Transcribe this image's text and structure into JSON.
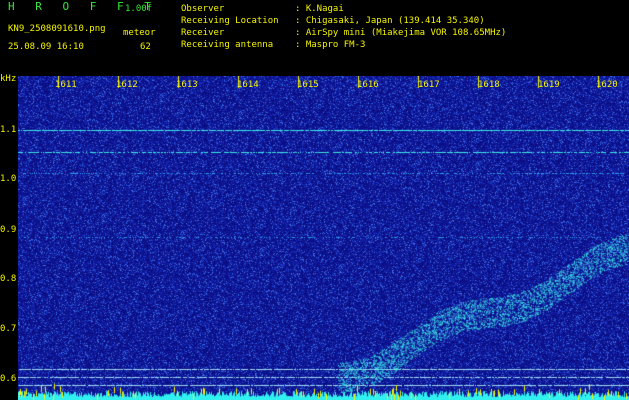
{
  "header": {
    "app_title": "H R O F F T",
    "version": "1.00f",
    "filename": "KN9_2508091610.png",
    "meteor_label": "meteor",
    "datetime": "25.08.09 16:10",
    "meteor_count": "62",
    "info": [
      {
        "label": "Observer",
        "value": ": K.Nagai"
      },
      {
        "label": "Receiving Location",
        "value": ": Chigasaki, Japan (139.414 35.340)"
      },
      {
        "label": "Receiver",
        "value": ": AirSpy mini (Miakejima VOR 108.65MHz)"
      },
      {
        "label": "Receiving antenna",
        "value": ": Maspro FM-3"
      }
    ]
  },
  "y_axis": {
    "unit": "kHz",
    "ticks": [
      "1.1",
      "1.0",
      "0.9",
      "0.8",
      "0.7",
      "0.6"
    ]
  },
  "time_axis": {
    "ticks": [
      "1611",
      "1612",
      "1613",
      "1614",
      "1615",
      "1616",
      "1617",
      "1618",
      "1619",
      "1620"
    ]
  },
  "colors": {
    "background_blue": "#0b0f86",
    "text_yellow": "#f4f400",
    "title_green": "#38e838",
    "signal_cyan": "#3ce8e8",
    "noise_bottom": "#30f0f0"
  }
}
